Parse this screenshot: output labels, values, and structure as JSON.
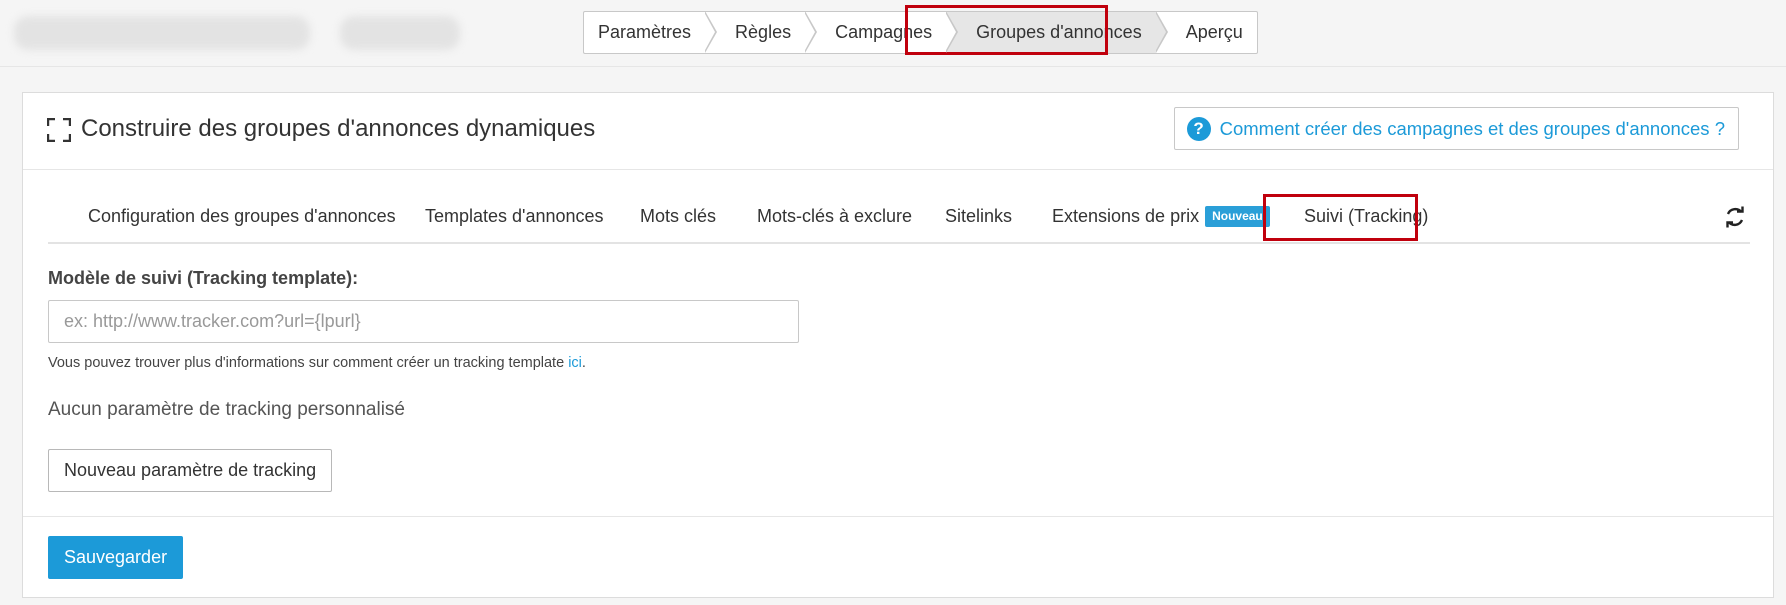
{
  "breadcrumb": {
    "steps": [
      "Paramètres",
      "Règles",
      "Campagnes",
      "Groupes d'annonces",
      "Aperçu"
    ],
    "active_index": 3
  },
  "panel": {
    "title": "Construire des groupes d'annonces dynamiques",
    "help_button": "Comment créer des campagnes et des groupes d'annonces ?"
  },
  "tabs": {
    "items": [
      "Configuration des groupes d'annonces",
      "Templates d'annonces",
      "Mots clés",
      "Mots-clés à exclure",
      "Sitelinks",
      "Extensions de prix",
      "Suivi (Tracking)"
    ],
    "badge": "Nouveau",
    "active": "Suivi (Tracking)"
  },
  "tracking": {
    "label": "Modèle de suivi (Tracking template):",
    "placeholder": "ex: http://www.tracker.com?url={lpurl}",
    "value": "",
    "help_prefix": "Vous pouvez trouver plus d'informations sur comment créer un tracking template ",
    "help_link": "ici",
    "help_suffix": ".",
    "no_params": "Aucun paramètre de tracking personnalisé",
    "new_param_button": "Nouveau paramètre de tracking"
  },
  "footer": {
    "save_button": "Sauvegarder"
  },
  "colors": {
    "accent": "#1c9ad8",
    "highlight": "#c0000d",
    "badge": "#2a9fd8"
  }
}
